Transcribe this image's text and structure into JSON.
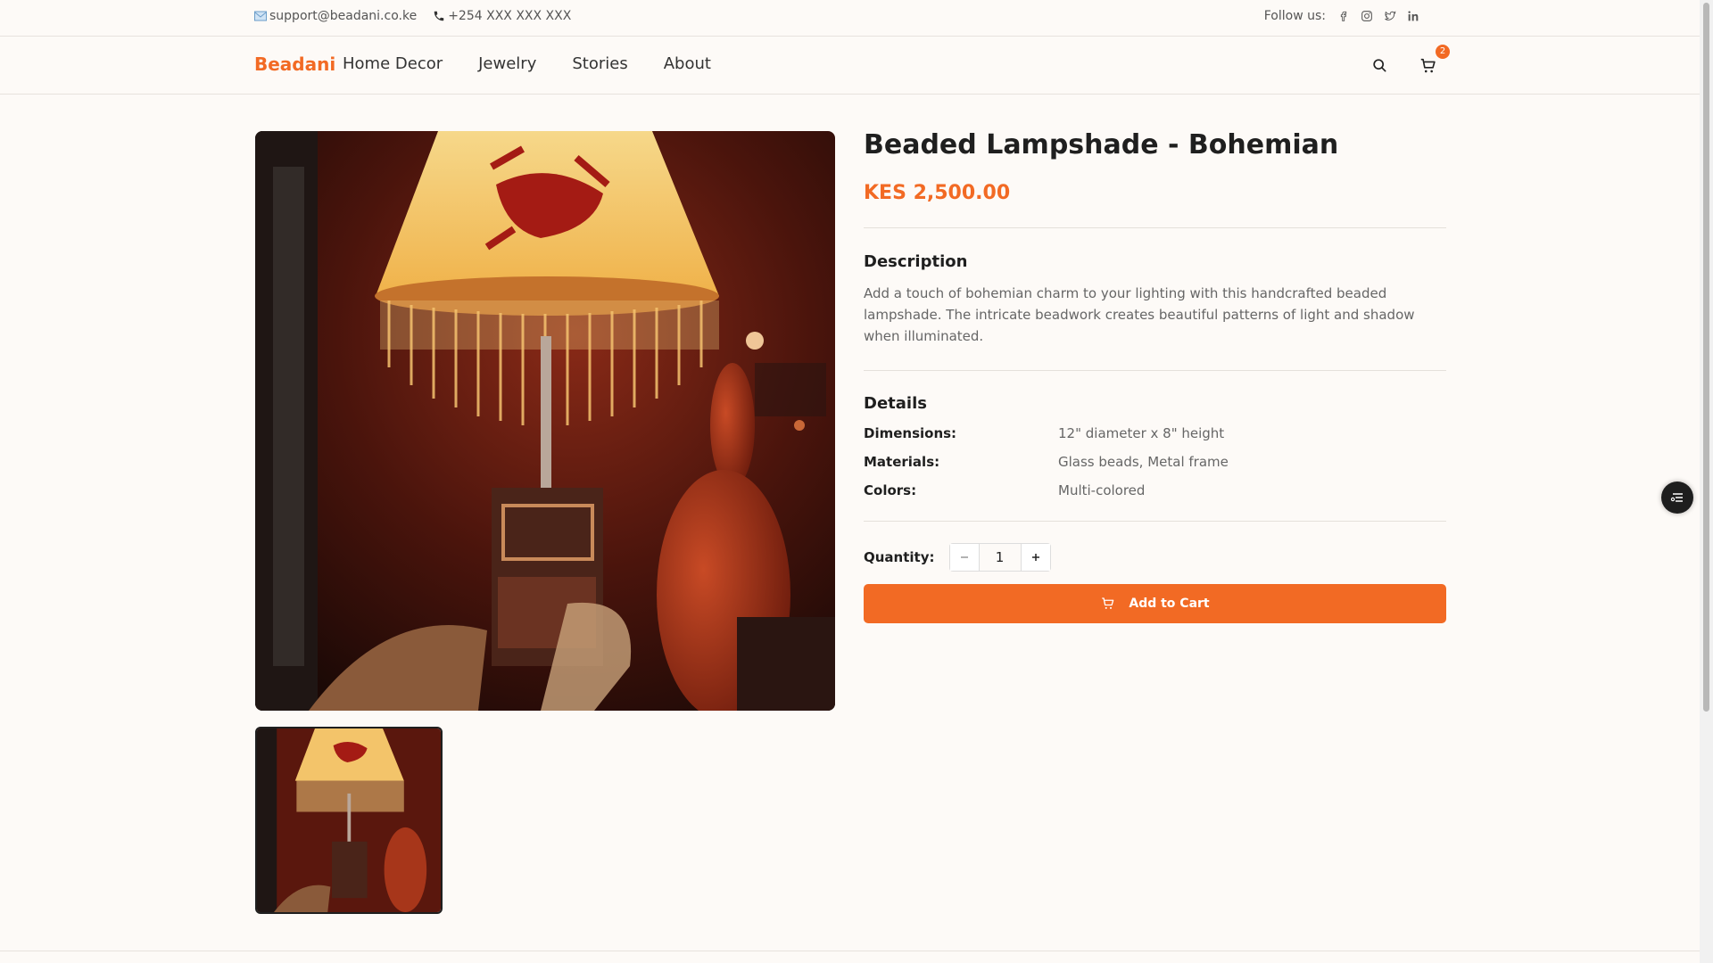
{
  "topbar": {
    "email": "support@beadani.co.ke",
    "phone": "+254 XXX XXX XXX",
    "follow_label": "Follow us:",
    "social_icons": [
      "facebook-icon",
      "instagram-icon",
      "twitter-icon",
      "linkedin-icon"
    ]
  },
  "nav": {
    "brand": "Beadani",
    "items": [
      "Home Decor",
      "Jewelry",
      "Stories",
      "About"
    ],
    "cart_count": "2"
  },
  "product": {
    "title": "Beaded Lampshade - Bohemian",
    "price": "KES 2,500.00",
    "description_title": "Description",
    "description": "Add a touch of bohemian charm to your lighting with this handcrafted beaded lampshade. The intricate beadwork creates beautiful patterns of light and shadow when illuminated.",
    "details_title": "Details",
    "details": [
      {
        "label": "Dimensions:",
        "value": "12\" diameter x 8\" height"
      },
      {
        "label": "Materials:",
        "value": "Glass beads, Metal frame"
      },
      {
        "label": "Colors:",
        "value": "Multi-colored"
      }
    ],
    "quantity_label": "Quantity:",
    "quantity": "1",
    "add_to_cart": "Add to Cart"
  },
  "colors": {
    "accent": "#f26a24",
    "background": "#fdfaf7"
  }
}
